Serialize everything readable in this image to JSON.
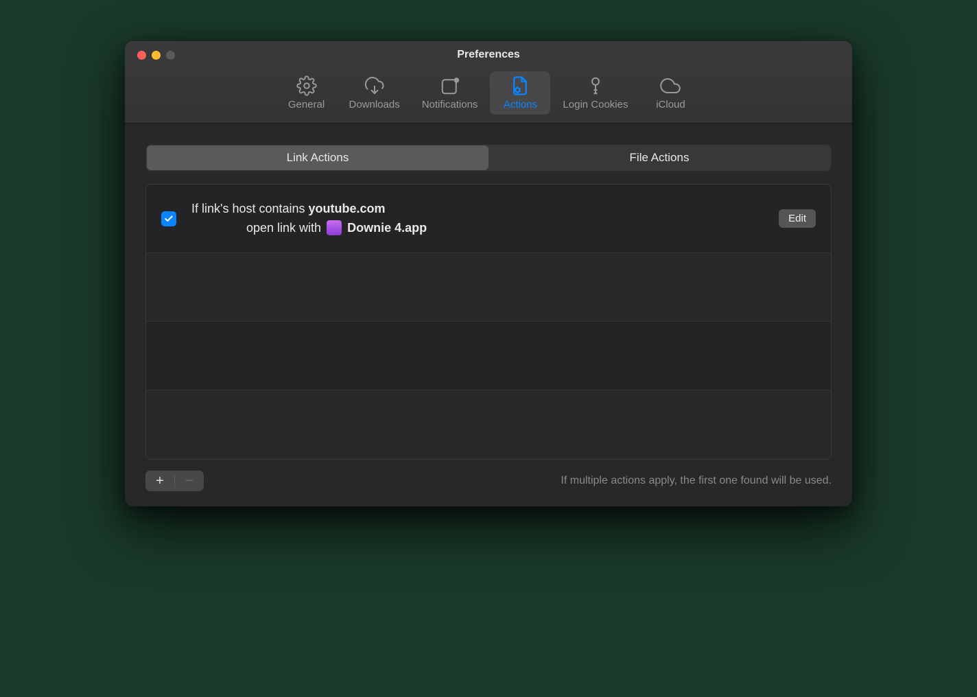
{
  "window": {
    "title": "Preferences"
  },
  "toolbar": {
    "items": [
      {
        "id": "general",
        "label": "General"
      },
      {
        "id": "downloads",
        "label": "Downloads"
      },
      {
        "id": "notifications",
        "label": "Notifications"
      },
      {
        "id": "actions",
        "label": "Actions",
        "active": true
      },
      {
        "id": "login-cookies",
        "label": "Login Cookies"
      },
      {
        "id": "icloud",
        "label": "iCloud"
      }
    ]
  },
  "segments": {
    "link_actions": "Link Actions",
    "file_actions": "File Actions",
    "selected": "link_actions"
  },
  "rules": [
    {
      "enabled": true,
      "condition_prefix": "If link's host contains ",
      "condition_value": "youtube.com",
      "action_prefix": "open link with",
      "app_name": "Downie 4.app",
      "edit_label": "Edit"
    }
  ],
  "footer": {
    "add_label": "+",
    "remove_label": "−",
    "hint": "If multiple actions apply, the first one found will be used."
  }
}
